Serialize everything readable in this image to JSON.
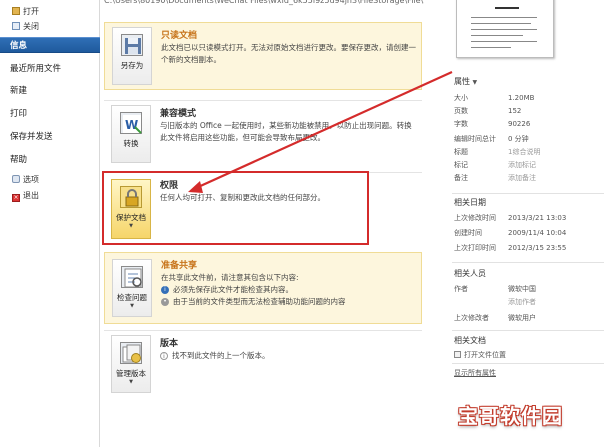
{
  "nav": {
    "open": "打开",
    "close": "关闭",
    "info": "信息",
    "recent": "最近所用文件",
    "new": "新建",
    "print": "打印",
    "save_send": "保存并发送",
    "help": "帮助",
    "options": "选项",
    "exit": "退出"
  },
  "path": "C:\\Users\\80190\\Documents\\WeChat Files\\wxid_6k55i9z5u94jn3\\FileStorage\\File\\2",
  "sections": {
    "readonly": {
      "title": "只读文档",
      "desc": "此文档已以只读模式打开。无法对原始文档进行更改。要保存更改，请创建一个新的文档副本。",
      "button": "另存为"
    },
    "compat": {
      "title": "兼容模式",
      "desc": "与旧版本的 Office 一起使用时，某些新功能被禁用，以防止出现问题。转换此文件将启用这些功能，但可能会导致布局更改。",
      "button": "转换"
    },
    "perm": {
      "title": "权限",
      "desc": "任何人均可打开、复制和更改此文档的任何部分。",
      "button": "保护文档"
    },
    "share": {
      "title": "准备共享",
      "desc": "在共享此文件前，请注意其包含以下内容:",
      "bullet1": "必须先保存此文件才能检查其内容。",
      "bullet2": "由于当前的文件类型而无法检查辅助功能问题的内容",
      "button": "检查问题"
    },
    "version": {
      "title": "版本",
      "desc": "找不到此文件的上一个版本。",
      "button": "管理版本"
    }
  },
  "properties": {
    "header": "属性",
    "rows": [
      {
        "k": "大小",
        "v": "1.20MB"
      },
      {
        "k": "页数",
        "v": "152"
      },
      {
        "k": "字数",
        "v": "90226"
      },
      {
        "k": "编辑时间总计",
        "v": "0 分钟"
      },
      {
        "k": "标题",
        "v": "1综合说明"
      },
      {
        "k": "标记",
        "v": "添加标记"
      },
      {
        "k": "备注",
        "v": "添加备注"
      }
    ]
  },
  "dates": {
    "header": "相关日期",
    "rows": [
      {
        "k": "上次修改时间",
        "v": "2013/3/21 13:03"
      },
      {
        "k": "创建时间",
        "v": "2009/11/4 10:04"
      },
      {
        "k": "上次打印时间",
        "v": "2012/3/15 23:55"
      }
    ]
  },
  "people": {
    "header": "相关人员",
    "rows": [
      {
        "k": "作者",
        "v": "微软中国"
      },
      {
        "k": "",
        "v": "添加作者"
      },
      {
        "k": "上次修改者",
        "v": "微软用户"
      }
    ]
  },
  "docs": {
    "header": "相关文档",
    "open_location": "打开文件位置",
    "show_all": "显示所有属性"
  },
  "watermark": "宝哥软件园"
}
